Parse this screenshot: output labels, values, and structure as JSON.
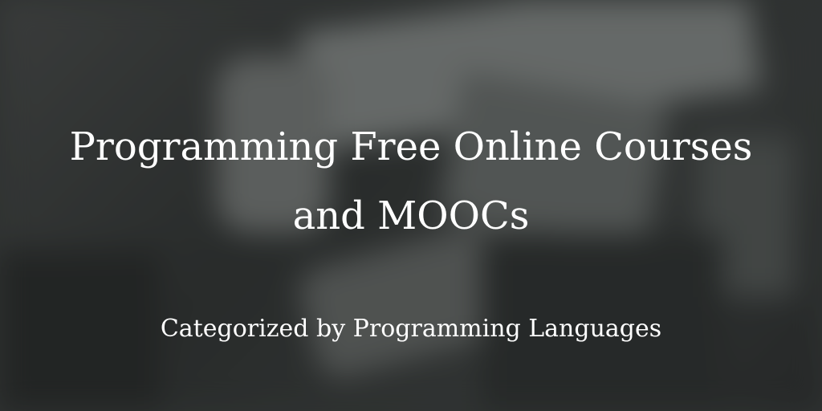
{
  "title_line1": "Programming Free Online Courses",
  "title_line2": "and MOOCs",
  "subtitle": "Categorized by Programming Languages"
}
